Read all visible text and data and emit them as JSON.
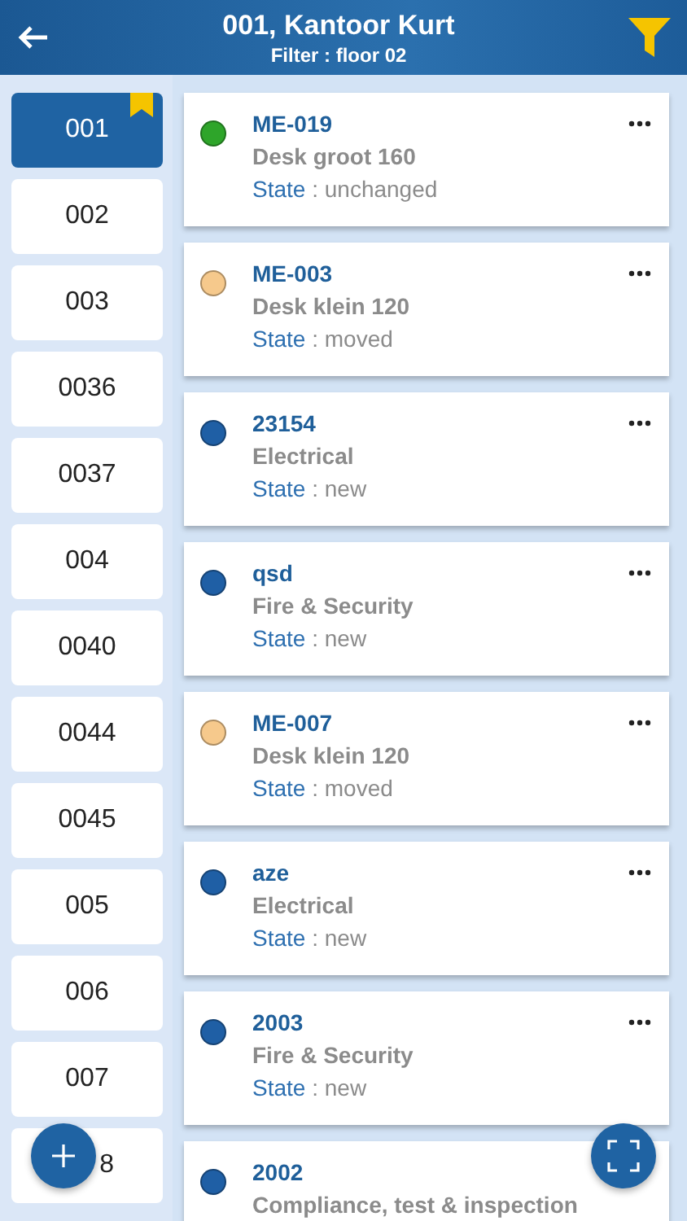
{
  "header": {
    "title": "001, Kantoor Kurt",
    "subtitle": "Filter : floor 02"
  },
  "rooms": [
    {
      "label": "001",
      "selected": true,
      "bookmarked": true
    },
    {
      "label": "002",
      "selected": false,
      "bookmarked": false
    },
    {
      "label": "003",
      "selected": false,
      "bookmarked": false
    },
    {
      "label": "0036",
      "selected": false,
      "bookmarked": false
    },
    {
      "label": "0037",
      "selected": false,
      "bookmarked": false
    },
    {
      "label": "004",
      "selected": false,
      "bookmarked": false
    },
    {
      "label": "0040",
      "selected": false,
      "bookmarked": false
    },
    {
      "label": "0044",
      "selected": false,
      "bookmarked": false
    },
    {
      "label": "0045",
      "selected": false,
      "bookmarked": false
    },
    {
      "label": "005",
      "selected": false,
      "bookmarked": false
    },
    {
      "label": "006",
      "selected": false,
      "bookmarked": false
    },
    {
      "label": "007",
      "selected": false,
      "bookmarked": false
    },
    {
      "label": "8",
      "selected": false,
      "bookmarked": false,
      "kind": "covered"
    }
  ],
  "assets": [
    {
      "code": "ME-019",
      "name": "Desk groot 160",
      "state_label": "State",
      "state": " : unchanged",
      "color": "#2ea52a",
      "menu": true
    },
    {
      "code": "ME-003",
      "name": "Desk klein 120",
      "state_label": "State",
      "state": " : moved",
      "color": "#f6c98c",
      "menu": true
    },
    {
      "code": "23154",
      "name": "Electrical",
      "state_label": "State",
      "state": " : new",
      "color": "#1f5fa5",
      "menu": true
    },
    {
      "code": "qsd",
      "name": "Fire & Security",
      "state_label": "State",
      "state": " : new",
      "color": "#1f5fa5",
      "menu": true
    },
    {
      "code": "ME-007",
      "name": "Desk klein 120",
      "state_label": "State",
      "state": " : moved",
      "color": "#f6c98c",
      "menu": true
    },
    {
      "code": "aze",
      "name": "Electrical",
      "state_label": "State",
      "state": " : new",
      "color": "#1f5fa5",
      "menu": true
    },
    {
      "code": "2003",
      "name": "Fire & Security",
      "state_label": "State",
      "state": " : new",
      "color": "#1f5fa5",
      "menu": true
    },
    {
      "code": "2002",
      "name": "Compliance, test & inspection",
      "color": "#1f5fa5",
      "menu": false
    }
  ]
}
